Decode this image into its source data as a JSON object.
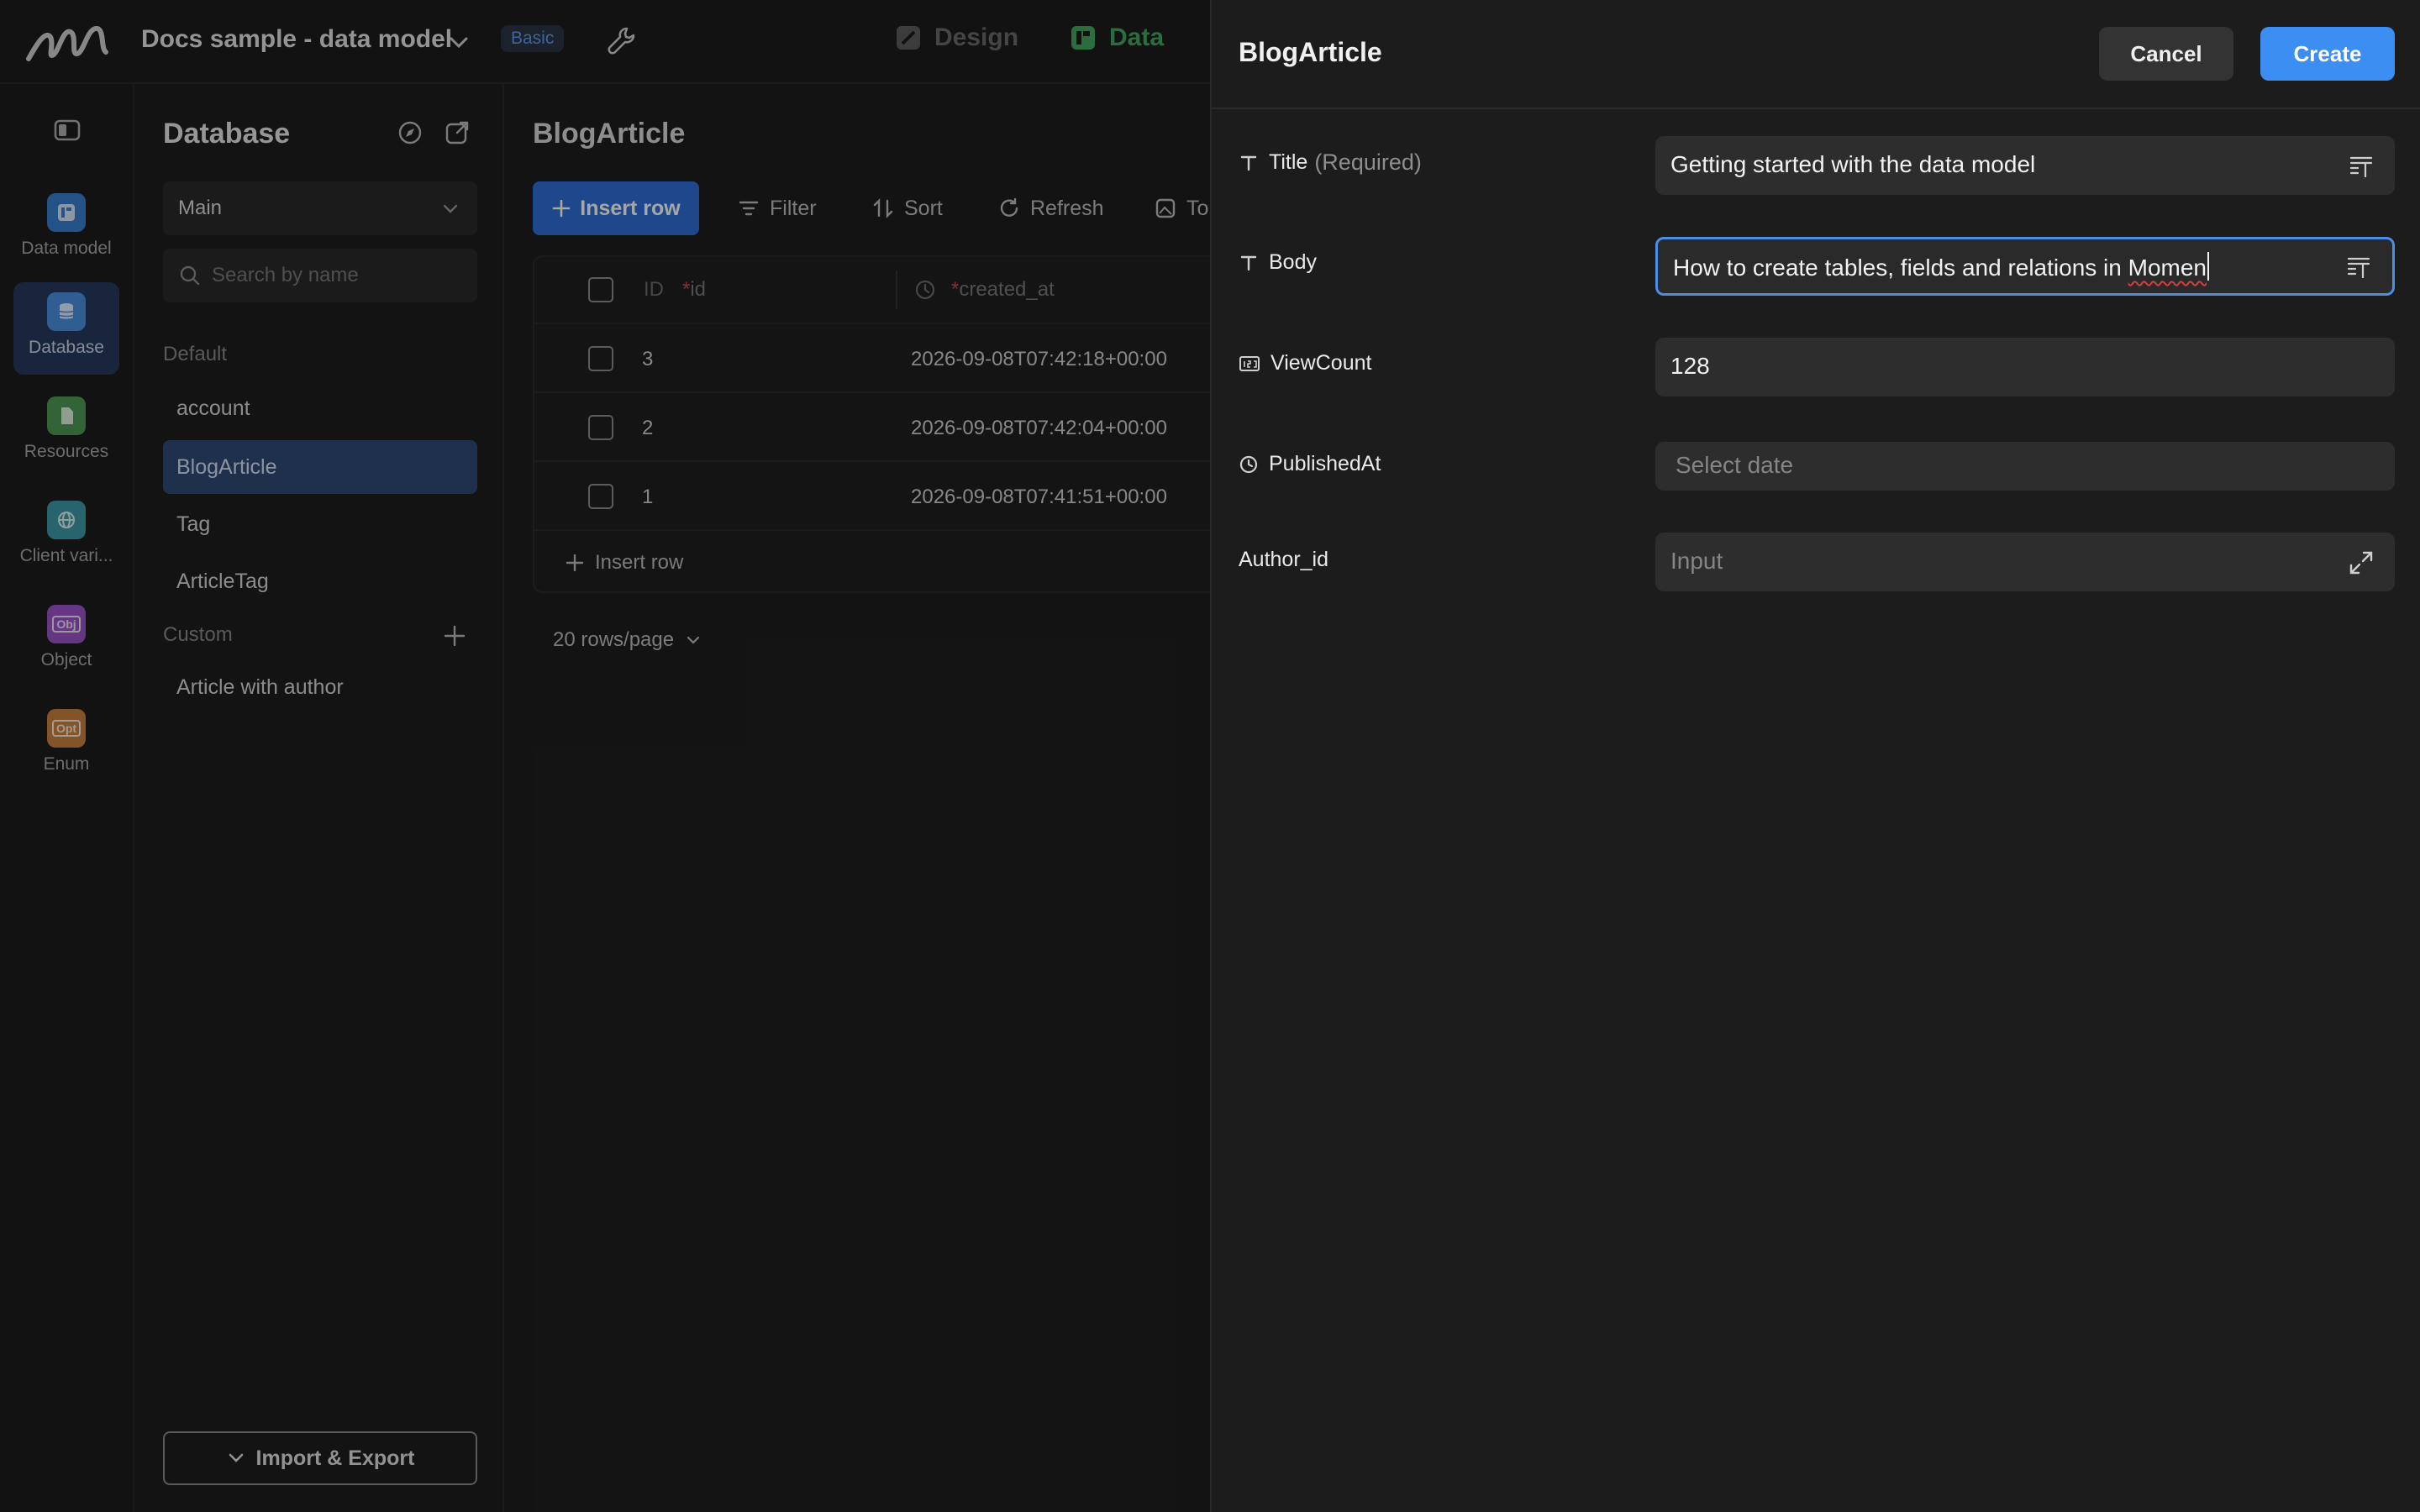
{
  "topbar": {
    "project_title": "Docs sample - data model",
    "plan_badge": "Basic",
    "mode_design": "Design",
    "mode_data": "Data"
  },
  "rail": {
    "items": [
      {
        "label": "Data model",
        "icon": "data-model-icon",
        "color": "#3a7fcf"
      },
      {
        "label": "Database",
        "icon": "database-icon",
        "color": "#4a90e0"
      },
      {
        "label": "Resources",
        "icon": "resources-icon",
        "color": "#4f9a57"
      },
      {
        "label": "Client vari...",
        "icon": "globe-icon",
        "color": "#3e9aa8"
      },
      {
        "label": "Object",
        "icon": "object-icon",
        "color": "#9b55c8"
      },
      {
        "label": "Enum",
        "icon": "enum-icon",
        "color": "#c9823f"
      }
    ],
    "object_glyph": "Obj",
    "enum_glyph": "Opt"
  },
  "db_panel": {
    "title": "Database",
    "select_value": "Main",
    "search_placeholder": "Search by name",
    "default_label": "Default",
    "default_tables": [
      "account",
      "BlogArticle",
      "Tag",
      "ArticleTag"
    ],
    "custom_label": "Custom",
    "custom_tables": [
      "Article with author"
    ],
    "import_export": "Import & Export"
  },
  "main": {
    "title": "BlogArticle",
    "insert_row": "Insert row",
    "filter": "Filter",
    "sort": "Sort",
    "refresh": "Refresh",
    "to": "To",
    "columns": {
      "id_prefix": "ID",
      "id": "id",
      "created_at": "created_at"
    },
    "rows": [
      {
        "id": "3",
        "created_at": "2026-09-08T07:42:18+00:00"
      },
      {
        "id": "2",
        "created_at": "2026-09-08T07:42:04+00:00"
      },
      {
        "id": "1",
        "created_at": "2026-09-08T07:41:51+00:00"
      }
    ],
    "insert_row_link": "Insert row",
    "rows_per_page": "20 rows/page"
  },
  "drawer": {
    "title": "BlogArticle",
    "cancel": "Cancel",
    "create": "Create",
    "fields": {
      "title": {
        "label": "Title",
        "required": "(Required)",
        "value": "Getting started with the data model"
      },
      "body": {
        "label": "Body",
        "value_prefix": "How to create tables, fields and relations in ",
        "value_misspelled": "Momen"
      },
      "view_count": {
        "label": "ViewCount",
        "value": "128"
      },
      "published_at": {
        "label": "PublishedAt",
        "placeholder": "Select date"
      },
      "author_id": {
        "label": "Author_id",
        "placeholder": "Input"
      }
    }
  }
}
